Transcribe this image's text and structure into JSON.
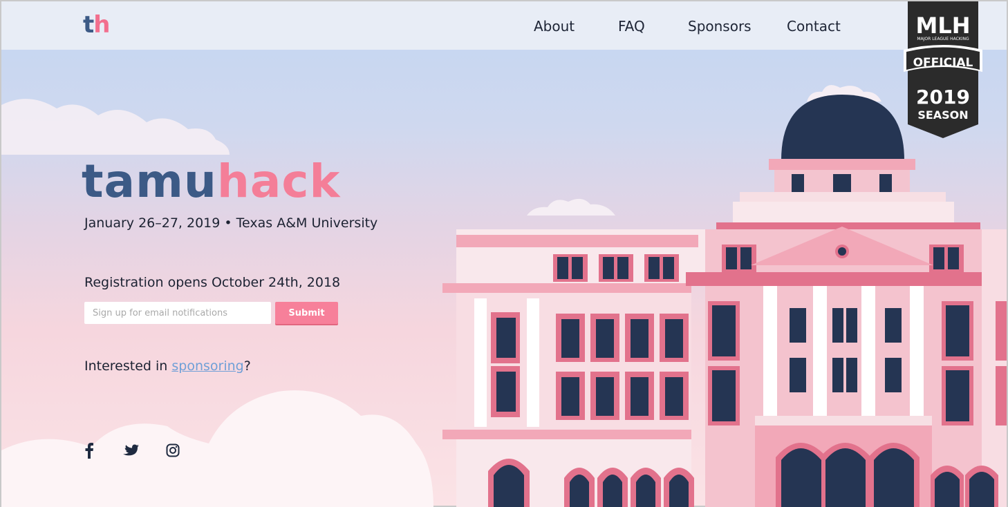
{
  "header": {
    "logo_t": "t",
    "logo_h": "h",
    "nav": [
      "About",
      "FAQ",
      "Sponsors",
      "Contact"
    ]
  },
  "badge": {
    "line1": "MLH",
    "line2": "MAJOR LEAGUE HACKING",
    "line3": "OFFICIAL",
    "line4": "2019",
    "line5": "SEASON"
  },
  "hero": {
    "brand_a": "tamu",
    "brand_b": "hack",
    "dateline": "January 26–27, 2019 • Texas A&M University",
    "registration": "Registration opens October 24th, 2018",
    "email_placeholder": "Sign up for email notifications",
    "submit_label": "Submit",
    "interest_prefix": "Interested in ",
    "interest_link": "sponsoring",
    "interest_suffix": "?"
  },
  "social": [
    "facebook-icon",
    "twitter-icon",
    "instagram-icon"
  ],
  "colors": {
    "navy": "#253553",
    "pink": "#f47e98",
    "blue_brand": "#3c5a86",
    "link": "#6f9fd7"
  }
}
